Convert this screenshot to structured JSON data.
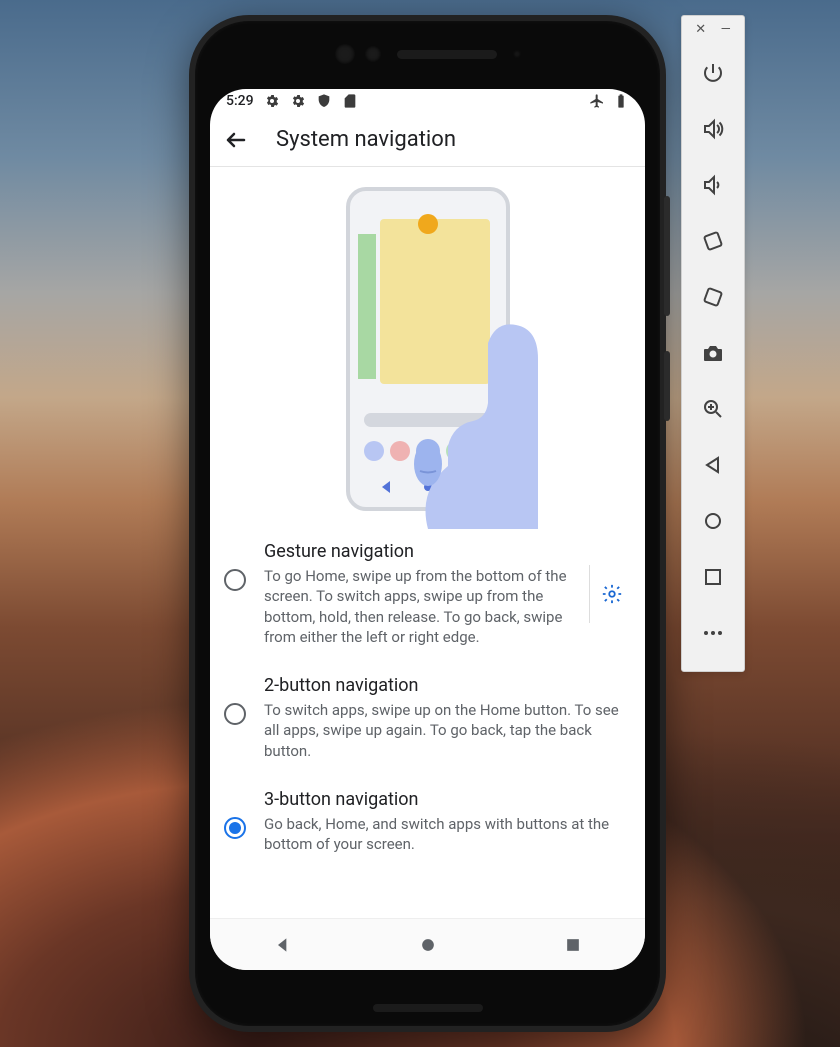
{
  "statusbar": {
    "time": "5:29"
  },
  "appbar": {
    "title": "System navigation"
  },
  "options": [
    {
      "title": "Gesture navigation",
      "desc": "To go Home, swipe up from the bottom of the screen. To switch apps, swipe up from the bottom, hold, then release. To go back, swipe from either the left or right edge.",
      "selected": false,
      "has_settings": true
    },
    {
      "title": "2-button navigation",
      "desc": "To switch apps, swipe up on the Home button. To see all apps, swipe up again. To go back, tap the back button.",
      "selected": false,
      "has_settings": false
    },
    {
      "title": "3-button navigation",
      "desc": "Go back, Home, and switch apps with buttons at the bottom of your screen.",
      "selected": true,
      "has_settings": false
    }
  ],
  "emulator_toolbar": [
    "power",
    "volume-up",
    "volume-down",
    "rotate-left",
    "rotate-right",
    "camera",
    "zoom-in",
    "back",
    "home",
    "overview",
    "more"
  ]
}
